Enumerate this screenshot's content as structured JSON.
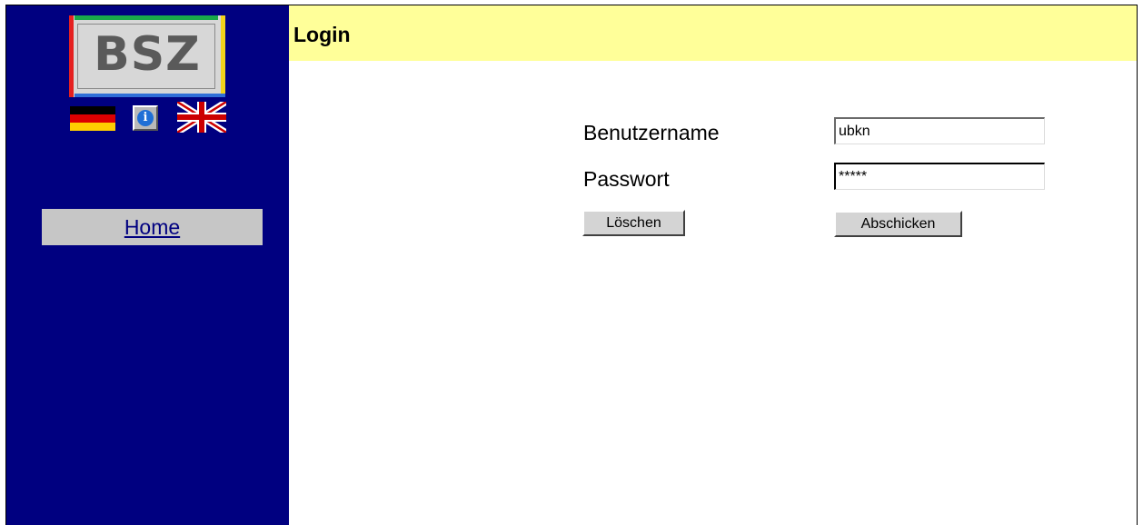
{
  "sidebar": {
    "logo_text": "BSZ",
    "language_de_icon": "german-flag-icon",
    "info_icon": "info-icon",
    "info_glyph": "i",
    "language_en_icon": "uk-flag-icon",
    "home_link": "Home"
  },
  "header": {
    "title": "Login"
  },
  "form": {
    "username_label": "Benutzername",
    "username_value": "ubkn",
    "password_label": "Passwort",
    "password_value": "*****",
    "reset_button": "Löschen",
    "submit_button": "Abschicken"
  },
  "colors": {
    "sidebar_bg": "#000080",
    "header_bg": "#ffff99",
    "home_box_bg": "#c6c6c6"
  }
}
